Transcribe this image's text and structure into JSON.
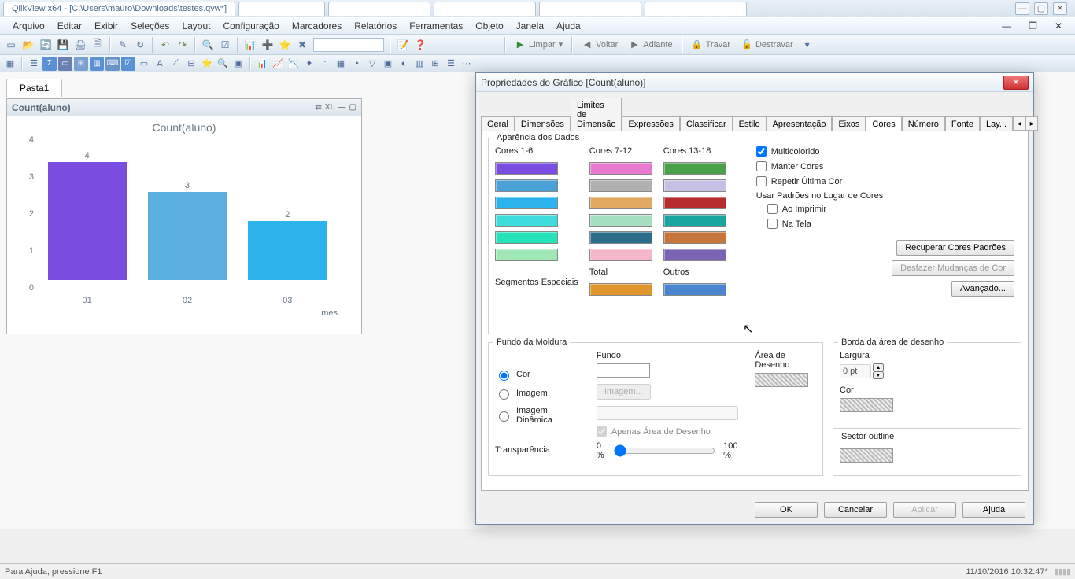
{
  "browser_tabs": [
    "QlikView x64 - [C:\\Users\\mauro\\Downloads\\testes.qvw*]",
    "",
    "",
    "",
    "",
    ""
  ],
  "titlebar": {
    "title": "QlikView x64 - [C:\\Users\\mauro\\Downloads\\testes.qvw*]"
  },
  "menu": [
    "Arquivo",
    "Editar",
    "Exibir",
    "Seleções",
    "Layout",
    "Configuração",
    "Marcadores",
    "Relatórios",
    "Ferramentas",
    "Objeto",
    "Janela",
    "Ajuda"
  ],
  "nav": {
    "limpar": "Limpar",
    "voltar": "Voltar",
    "adiante": "Adiante",
    "travar": "Travar",
    "destravar": "Destravar"
  },
  "sheet_tab": "Pasta1",
  "chart": {
    "header": "Count(aluno)",
    "title": "Count(aluno)",
    "xlabel": "mes"
  },
  "chart_data": {
    "type": "bar",
    "categories": [
      "01",
      "02",
      "03"
    ],
    "values": [
      4,
      3,
      2
    ],
    "title": "Count(aluno)",
    "xlabel": "mes",
    "ylabel": "",
    "ylim": [
      0,
      4
    ],
    "colors": [
      "#7b4ce0",
      "#5aaee0",
      "#2cb3ec"
    ]
  },
  "dialog": {
    "title": "Propriedades do Gráfico [Count(aluno)]",
    "tabs": [
      "Geral",
      "Dimensões",
      "Limites de Dimensão",
      "Expressões",
      "Classificar",
      "Estilo",
      "Apresentação",
      "Eixos",
      "Cores",
      "Número",
      "Fonte",
      "Lay..."
    ],
    "active_tab": "Cores",
    "appearance_group": "Aparência dos Dados",
    "col_headers": [
      "Cores 1-6",
      "Cores 7-12",
      "Cores 13-18"
    ],
    "swatches": {
      "c1": [
        "#7b4ce0",
        "#5aaee0",
        "#2cb3ec",
        "#25e3b8",
        "#a0e7b6"
      ],
      "c1b": "#4aa1d8",
      "c2": [
        "#e87ad0",
        "#b0b0b0",
        "#e0a860",
        "#a4dfc0",
        "#2a6c8a",
        "#f4b6c8"
      ],
      "c3": [
        "#4aa048",
        "#c6c0e4",
        "#b62c2c",
        "#1aa6a0",
        "#c6763a",
        "#7a62b4"
      ]
    },
    "total_label": "Total",
    "outros_label": "Outros",
    "total_color": "#e0962c",
    "outros_color": "#4a86d0",
    "seg_label": "Segmentos Especiais",
    "multicolor": "Multicolorido",
    "keep_colors": "Manter Cores",
    "repeat_last": "Repetir Última Cor",
    "use_patterns": "Usar Padrões no Lugar de Cores",
    "on_print": "Ao Imprimir",
    "on_screen": "Na Tela",
    "btn_recover": "Recuperar Cores Padrões",
    "btn_undo": "Desfazer Mudanças de Cor",
    "btn_advanced": "Avançado...",
    "frame_group": "Fundo da Moldura",
    "frame_color": "Cor",
    "frame_image": "Imagem",
    "frame_dynimg": "Imagem Dinâmica",
    "bg_label": "Fundo",
    "plot_label": "Área de Desenho",
    "image_btn": "Imagem...",
    "only_plot": "Apenas Área de Desenho",
    "transparency": "Transparência",
    "t0": "0 %",
    "t100": "100 %",
    "plot_border_group": "Borda da área de desenho",
    "width_label": "Largura",
    "width_val": "0 pt",
    "color_label": "Cor",
    "sector_label": "Sector outline",
    "buttons": {
      "ok": "OK",
      "cancel": "Cancelar",
      "apply": "Aplicar",
      "help": "Ajuda"
    }
  },
  "status": {
    "help": "Para Ajuda, pressione F1",
    "dt": "11/10/2016 10:32:47*"
  }
}
